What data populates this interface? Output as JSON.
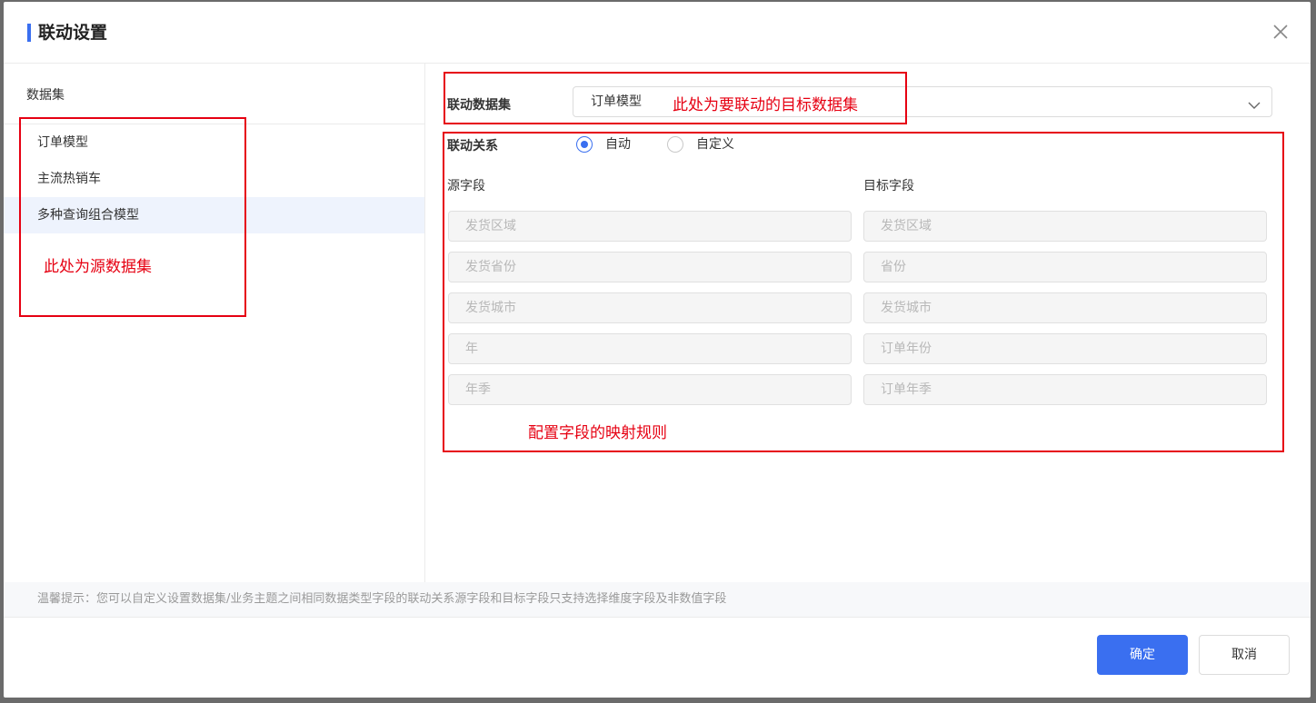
{
  "dialog": {
    "title": "联动设置"
  },
  "left": {
    "heading": "数据集",
    "datasets": [
      "订单模型",
      "主流热销车",
      "多种查询组合模型"
    ],
    "active_index": 2
  },
  "right": {
    "linked_dataset_label": "联动数据集",
    "linked_dataset_value": "订单模型",
    "relation_label": "联动关系",
    "relation_options": [
      "自动",
      "自定义"
    ],
    "relation_selected": "自动",
    "source_header": "源字段",
    "target_header": "目标字段",
    "mappings": [
      {
        "source": "发货区域",
        "target": "发货区域"
      },
      {
        "source": "发货省份",
        "target": "省份"
      },
      {
        "source": "发货城市",
        "target": "发货城市"
      },
      {
        "source": "年",
        "target": "订单年份"
      },
      {
        "source": "年季",
        "target": "订单年季"
      }
    ]
  },
  "tip": "温馨提示：您可以自定义设置数据集/业务主题之间相同数据类型字段的联动关系源字段和目标字段只支持选择维度字段及非数值字段",
  "buttons": {
    "confirm": "确定",
    "cancel": "取消"
  },
  "annotations": {
    "target_dataset": "此处为要联动的目标数据集",
    "source_dataset": "此处为源数据集",
    "mapping_rules": "配置字段的映射规则",
    "color": "#e60012"
  },
  "colors": {
    "accent": "#3a6ff0",
    "active_row": "#eef3fd"
  }
}
